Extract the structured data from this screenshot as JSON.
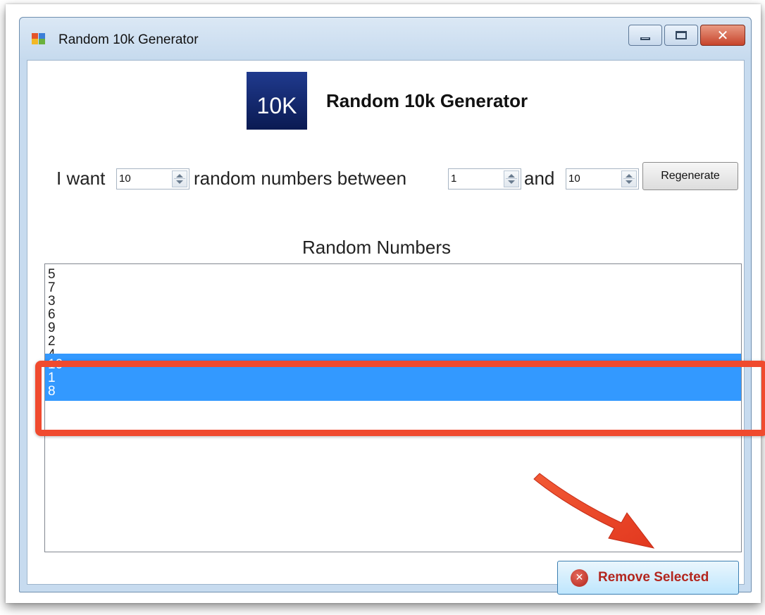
{
  "window": {
    "title": "Random 10k Generator",
    "controls": {
      "minimize": "minimize-icon",
      "maximize": "maximize-icon",
      "close": "close-icon"
    }
  },
  "header": {
    "logo_text": "10K",
    "title": "Random 10k Generator"
  },
  "form": {
    "label_want": "I want",
    "count_value": "10",
    "label_between": "random numbers between",
    "min_value": "1",
    "label_and": "and",
    "max_value": "10",
    "regenerate_label": "Regenerate"
  },
  "list": {
    "title": "Random Numbers",
    "items": [
      "5",
      "7",
      "3",
      "6",
      "9",
      "2",
      "4",
      "10",
      "1",
      "8"
    ],
    "selected_items": [
      "10",
      "1",
      "8"
    ]
  },
  "actions": {
    "remove_selected_label": "Remove Selected"
  },
  "colors": {
    "selection": "#3399ff",
    "annotation": "#f04a2e",
    "logo": "#14287a"
  }
}
